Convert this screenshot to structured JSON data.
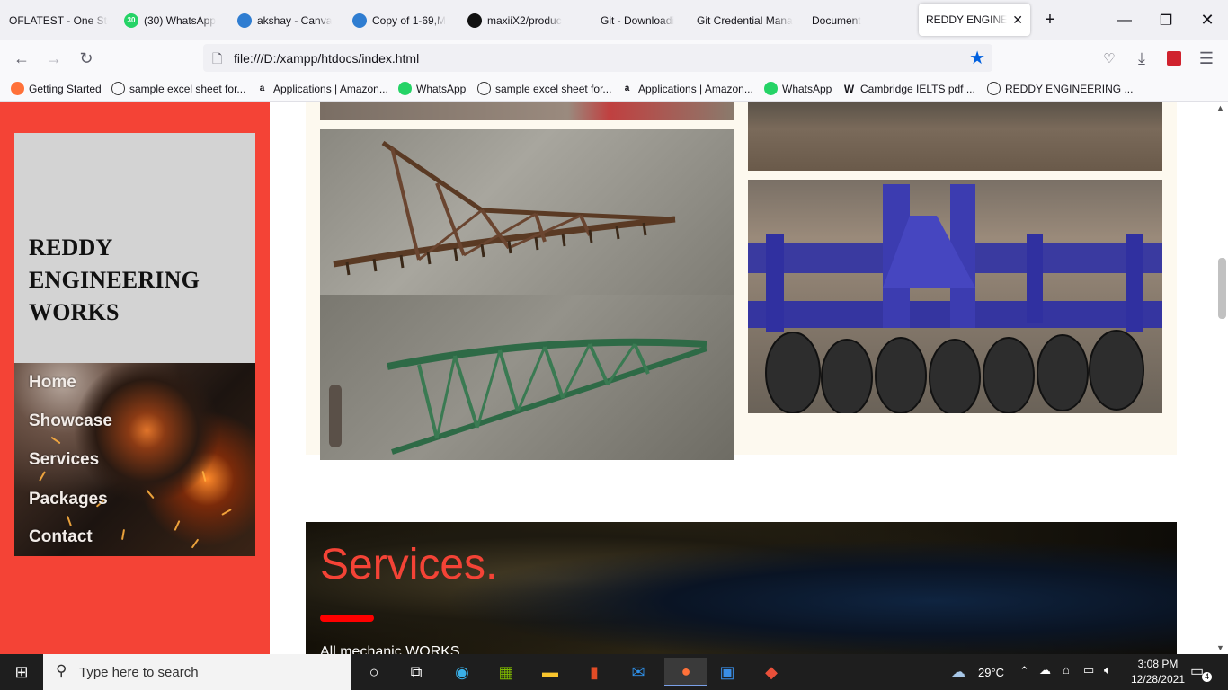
{
  "tabs": [
    {
      "title": "OFLATEST - One Sto",
      "icon": "none"
    },
    {
      "title": "(30) WhatsApp",
      "icon": "whatsapp-icon"
    },
    {
      "title": "akshay - Canva",
      "icon": "edge-icon"
    },
    {
      "title": "Copy of 1-69,M",
      "icon": "edge-icon"
    },
    {
      "title": "maxiiX2/produc",
      "icon": "github-icon"
    },
    {
      "title": "Git - Downloadi",
      "icon": "none"
    },
    {
      "title": "Git Credential Mana",
      "icon": "none"
    },
    {
      "title": "Document",
      "icon": "none"
    },
    {
      "title": "REDDY ENGINEER",
      "icon": "none",
      "active": true
    }
  ],
  "whatsapp_badge": "30",
  "url": "file:///D:/xampp/htdocs/index.html",
  "bookmarks": [
    {
      "label": "Getting Started",
      "icon": "firefox-icon"
    },
    {
      "label": "sample excel sheet for...",
      "icon": "globe-icon"
    },
    {
      "label": "Applications | Amazon...",
      "icon": "amazon-icon"
    },
    {
      "label": "WhatsApp",
      "icon": "whatsapp-icon"
    },
    {
      "label": "sample excel sheet for...",
      "icon": "globe-icon"
    },
    {
      "label": "Applications | Amazon...",
      "icon": "amazon-icon"
    },
    {
      "label": "WhatsApp",
      "icon": "whatsapp-icon"
    },
    {
      "label": "Cambridge IELTS pdf ...",
      "icon": "w-icon"
    },
    {
      "label": "REDDY ENGINEERING ...",
      "icon": "globe-icon"
    }
  ],
  "site": {
    "brand": "REDDY ENGINEERING WORKS",
    "menu": [
      "Home",
      "Showcase",
      "Services",
      "Packages",
      "Contact"
    ],
    "services_title": "Services.",
    "services_sub": "All mechanic WORKS",
    "accent": "#f44336"
  },
  "taskbar": {
    "search_placeholder": "Type here to search",
    "weather": "29°C",
    "time": "3:08 PM",
    "date": "12/28/2021",
    "notifications": "4"
  }
}
